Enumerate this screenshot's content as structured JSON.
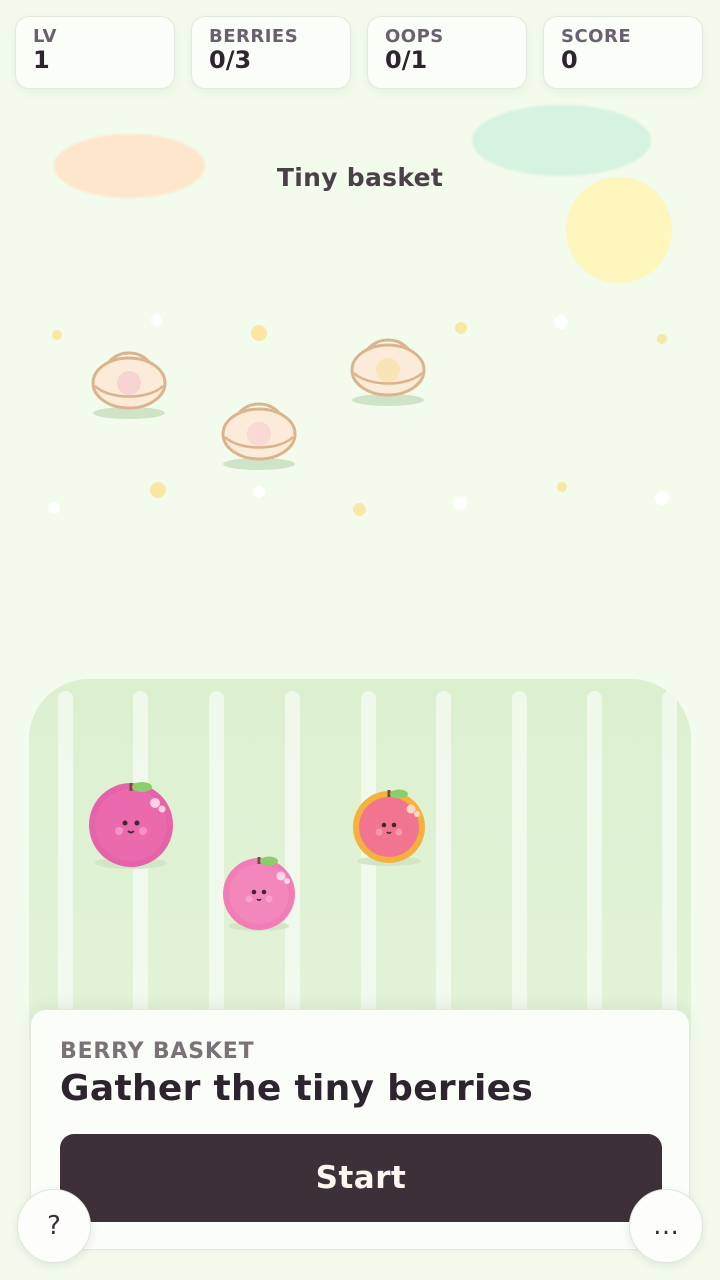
{
  "hud": {
    "level": {
      "label": "LV",
      "value": "1"
    },
    "berries": {
      "label": "BERRIES",
      "value": "0/3"
    },
    "oops": {
      "label": "OOPS",
      "value": "0/1"
    },
    "score": {
      "label": "SCORE",
      "value": "0"
    }
  },
  "scene": {
    "title": "Tiny basket",
    "baskets": [
      {
        "name": "basket-left",
        "content_color": "#f7d3d3"
      },
      {
        "name": "basket-middle",
        "content_color": "#f8d9d4"
      },
      {
        "name": "basket-right",
        "content_color": "#f9e4b8"
      }
    ],
    "berries": [
      {
        "name": "berry-magenta",
        "body_color": "#e563a8"
      },
      {
        "name": "berry-pink",
        "body_color": "#f07db5"
      },
      {
        "name": "berry-peach",
        "body_color": "#f2758f",
        "rim_color": "#f4b23c"
      }
    ]
  },
  "card": {
    "kicker": "BERRY BASKET",
    "headline": "Gather the tiny berries",
    "start_label": "Start"
  },
  "buttons": {
    "help_label": "?",
    "more_label": "…"
  },
  "colors": {
    "background": "#f2fbec",
    "button_dark": "#3d3038",
    "text_dark": "#2e2430"
  }
}
